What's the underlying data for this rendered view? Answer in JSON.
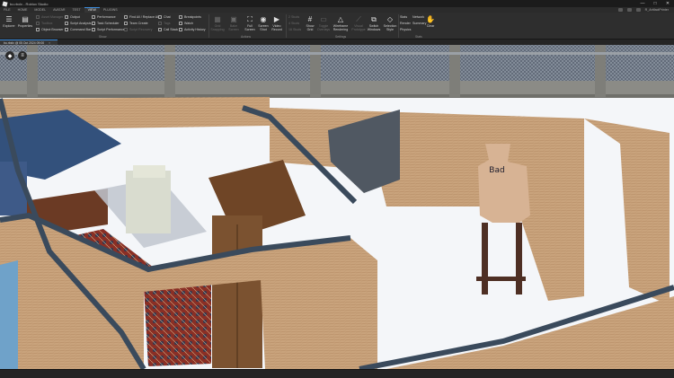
{
  "titlebar": {
    "title": "bo.rbxlx - Roblox Studio",
    "min": "—",
    "max": "□",
    "close": "✕"
  },
  "menubar": {
    "tabs": [
      {
        "label": "FILE",
        "active": false
      },
      {
        "label": "HOME",
        "active": false
      },
      {
        "label": "MODEL",
        "active": false
      },
      {
        "label": "AVATAR",
        "active": false
      },
      {
        "label": "TEST",
        "active": false
      },
      {
        "label": "VIEW",
        "active": true
      },
      {
        "label": "PLUGINS",
        "active": false
      }
    ],
    "user": "R_ArtifactPrinter"
  },
  "ribbon": {
    "explorer": "Explorer",
    "properties": "Properties",
    "show_col1": [
      "Asset Manager",
      "Toolbox",
      "Object Browser"
    ],
    "show_col2": [
      "Output",
      "Script Analysis",
      "Command Bar"
    ],
    "show_col3": [
      "Performance",
      "Task Scheduler",
      "Script Performance"
    ],
    "show_col4": [
      "Find All / Replace All",
      "Team Create",
      "Script Recovery"
    ],
    "show_col5": [
      "Chat",
      "Tags",
      "Call Stack"
    ],
    "show_col6": [
      "Breakpoints",
      "Watch",
      "Activity History"
    ],
    "show_group": "Show",
    "actions_group": "Actions",
    "actions": [
      "Grid Snapping",
      "Bake Screen",
      "Full Screen",
      "Screen Shot",
      "Video Record"
    ],
    "settings_group": "Settings",
    "studs": [
      "2 Studs",
      "4 Studs",
      "16 Studs"
    ],
    "settings": [
      "Show Grid",
      "Toggle Overlays",
      "Wireframe Rendering",
      "Visual Prototype",
      "Switch Windows",
      "Selection Style"
    ],
    "stats_col": [
      "Stats",
      "Render",
      "Physics"
    ],
    "network": [
      "Network",
      "Summary"
    ],
    "clear": "Clear",
    "stats_group": "Stats"
  },
  "docbar": {
    "tab_label": "bo.rbxlx @ 05 Oct 2024 09:00",
    "close": "×"
  },
  "viewport": {
    "target_text": "Bad"
  }
}
